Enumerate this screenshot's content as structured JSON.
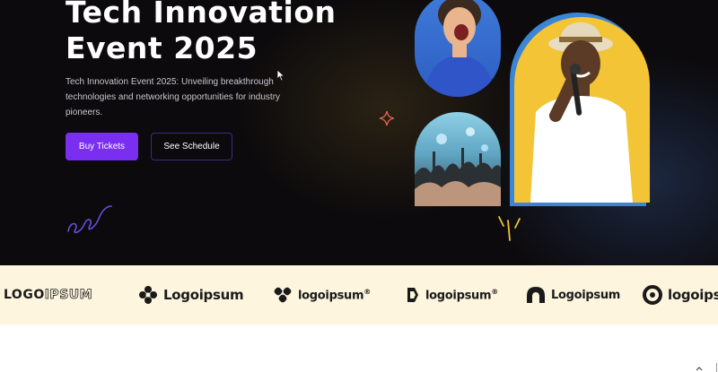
{
  "hero": {
    "title_line1": "Tech Innovation",
    "title_line2": "Event 2025",
    "description": "Tech Innovation Event 2025: Unveiling breakthrough technologies and networking opportunities for industry pioneers.",
    "buy_button": "Buy Tickets",
    "schedule_button": "See Schedule"
  },
  "logos": [
    {
      "text": "LOGOIPSUM",
      "icon": "logoipsum-wordmark"
    },
    {
      "text": "Logoipsum",
      "icon": "flower-icon"
    },
    {
      "text": "logoipsum",
      "icon": "chain-icon",
      "mark": "®"
    },
    {
      "text": "logoipsum",
      "icon": "bracket-icon",
      "mark": "®"
    },
    {
      "text": "Logoipsum",
      "icon": "arch-icon"
    },
    {
      "text": "logoipsum",
      "icon": "ring-icon"
    }
  ],
  "colors": {
    "hero_bg": "#0c0a0c",
    "accent": "#7a2ef0",
    "outline": "#3b2c86",
    "logo_strip": "#fdf5de",
    "photo_frame": "#3a85d6",
    "photo_main_bg": "#f2c436"
  }
}
